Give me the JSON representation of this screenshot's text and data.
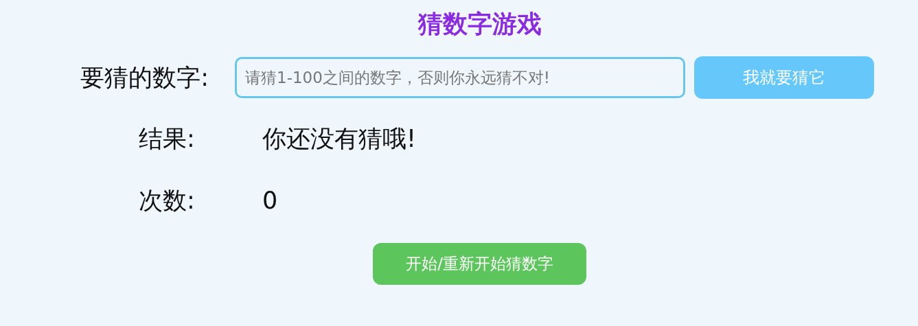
{
  "title": "猜数字游戏",
  "guess": {
    "label": "要猜的数字:",
    "placeholder": "请猜1-100之间的数字，否则你永远猜不对!",
    "button": "我就要猜它"
  },
  "result": {
    "label": "结果:",
    "value": "你还没有猜哦!"
  },
  "count": {
    "label": "次数:",
    "value": "0"
  },
  "restart_button": "开始/重新开始猜数字"
}
